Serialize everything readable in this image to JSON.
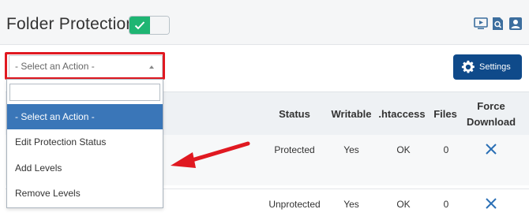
{
  "header": {
    "title": "Folder Protection",
    "toggle_state": "on",
    "icons": [
      "video-icon",
      "search-doc-icon",
      "user-card-icon"
    ]
  },
  "toolbar": {
    "action_select_value": "- Select an Action -",
    "settings_label": "Settings"
  },
  "dropdown": {
    "search_placeholder": "",
    "options": [
      "- Select an Action -",
      "Edit Protection Status",
      "Add Levels",
      "Remove Levels"
    ],
    "selected_index": 0
  },
  "table": {
    "columns": [
      "Status",
      "Writable",
      ".htaccess",
      "Files",
      "Force",
      "Download"
    ],
    "rows": [
      {
        "status": "Protected",
        "writable": "Yes",
        "htaccess": "OK",
        "files": "0",
        "force_download": "x-icon"
      },
      {
        "status": "Unprotected",
        "writable": "Yes",
        "htaccess": "OK",
        "files": "0",
        "force_download": "x-icon"
      }
    ]
  },
  "colors": {
    "accent_blue": "#0f4a8a",
    "toggle_green": "#1fb573",
    "highlight_red": "#e01921",
    "selected_option": "#3a76b8",
    "x_icon": "#2a6fb5"
  }
}
